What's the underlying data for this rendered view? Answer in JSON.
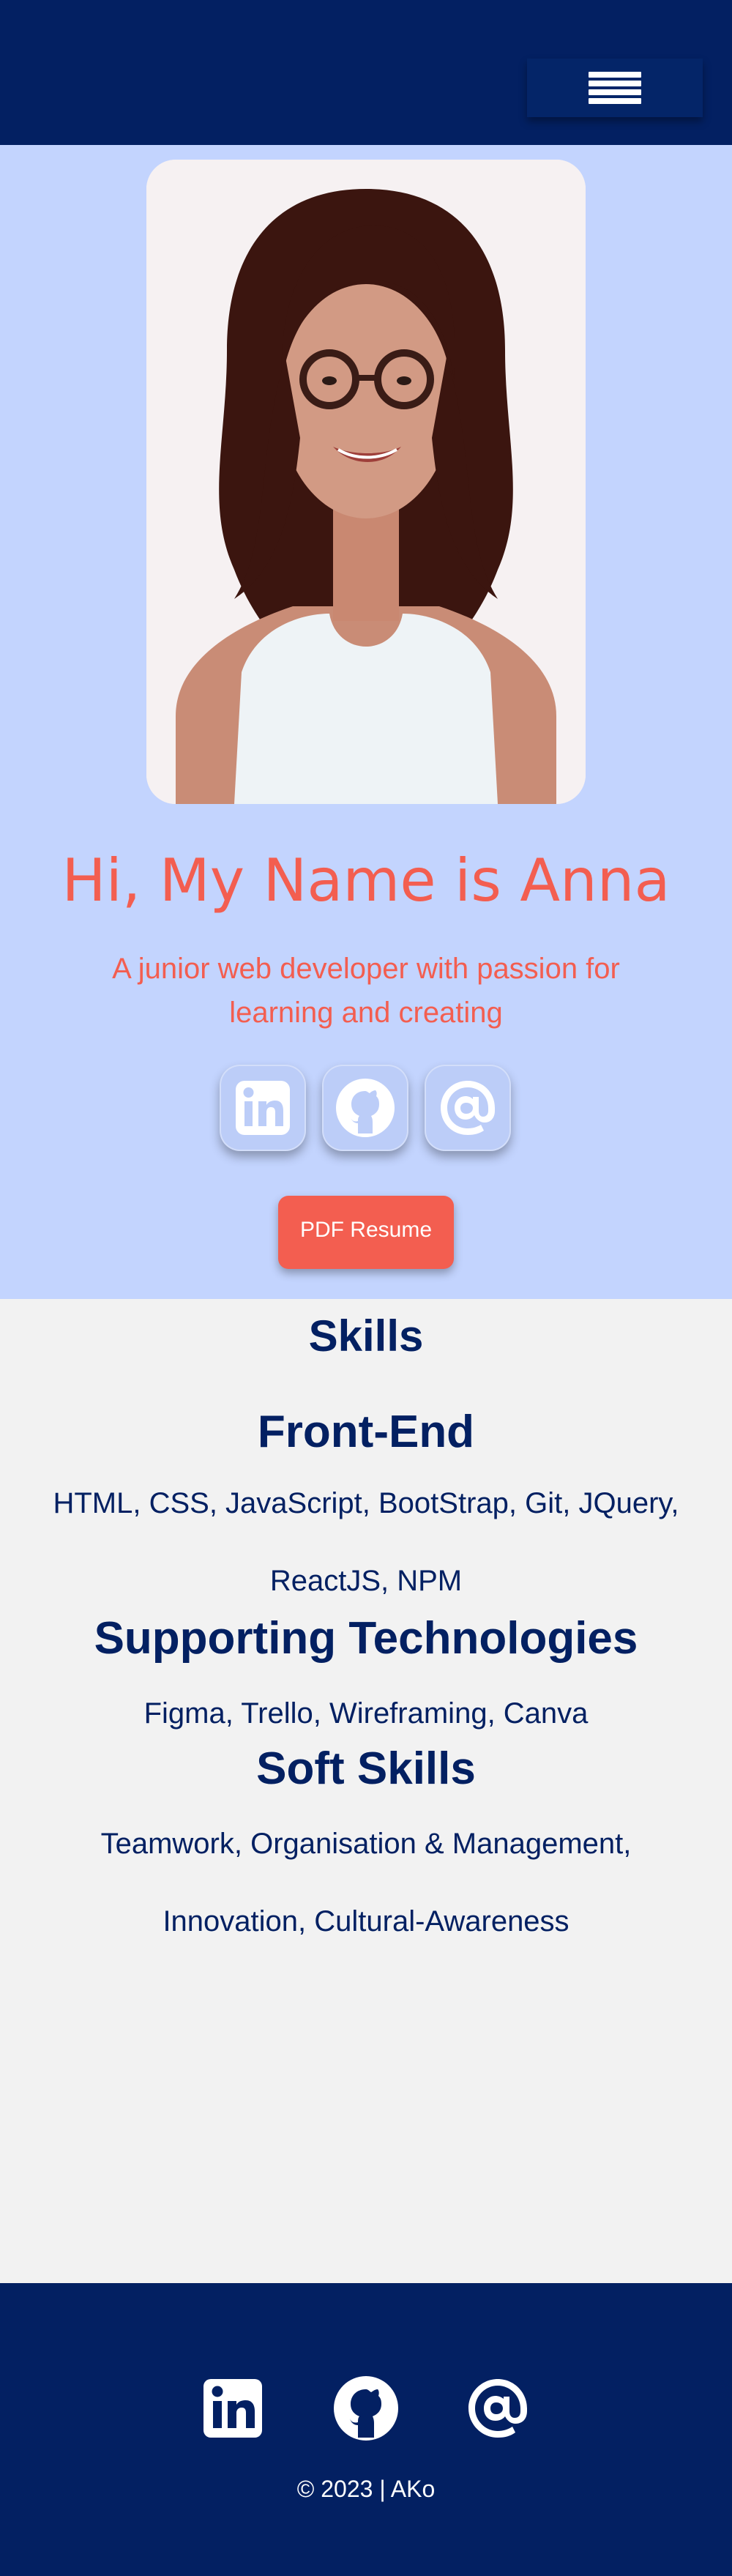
{
  "header": {
    "menu_icon": "hamburger-menu-icon"
  },
  "hero": {
    "portrait_alt": "portrait-photo",
    "greeting": "Hi, My Name is Anna",
    "tagline": "A junior web developer with passion for learning and creating",
    "social_icons": [
      "linkedin-icon",
      "github-icon",
      "at-sign-icon"
    ],
    "resume_button": "PDF Resume"
  },
  "skills": {
    "title": "Skills",
    "front_end": {
      "heading": "Front-End",
      "text": "HTML, CSS, JavaScript, BootStrap, Git, JQuery, ReactJS, NPM"
    },
    "supporting": {
      "heading": "Supporting Technologies",
      "text": "Figma, Trello, Wireframing, Canva"
    },
    "soft": {
      "heading": "Soft Skills",
      "text": "Teamwork, Organisation & Management, Innovation, Cultural-Awareness"
    }
  },
  "footer": {
    "social_icons": [
      "linkedin-icon",
      "github-icon",
      "at-sign-icon"
    ],
    "copyright": "© 2023 | AKo"
  },
  "colors": {
    "navy": "#032062",
    "hero_bg": "#c3d4fe",
    "accent": "#f35e50",
    "page_bg": "#f2f2f2"
  }
}
